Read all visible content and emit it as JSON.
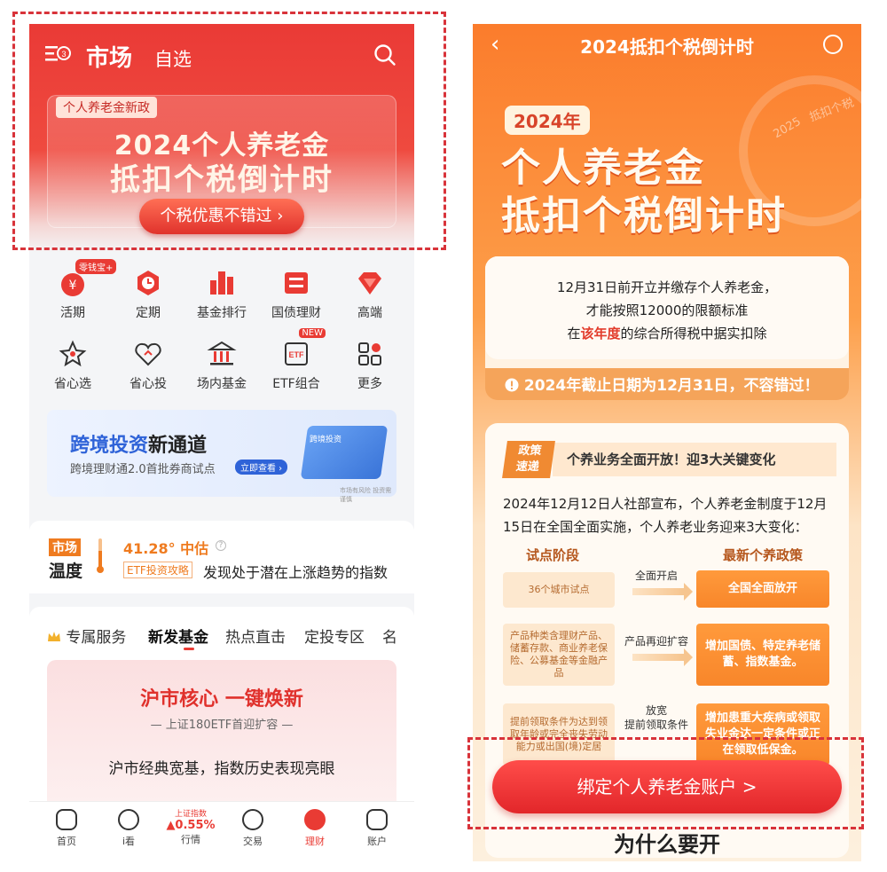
{
  "left": {
    "header": {
      "tab_market": "市场",
      "tab_favorites": "自选",
      "menu_badge": "3"
    },
    "banner": {
      "tag": "个人养老金新政",
      "title_line1": "2024个人养老金",
      "title_line2": "抵扣个税倒计时",
      "button": "个税优惠不错过 ›"
    },
    "grid": [
      {
        "label": "活期",
        "badge": "零钱宝+"
      },
      {
        "label": "定期"
      },
      {
        "label": "基金排行"
      },
      {
        "label": "国债理财"
      },
      {
        "label": "高端"
      },
      {
        "label": "省心选"
      },
      {
        "label": "省心投"
      },
      {
        "label": "场内基金"
      },
      {
        "label": "ETF组合",
        "badge": "NEW"
      },
      {
        "label": "更多"
      }
    ],
    "cross_card": {
      "title_blue": "跨境投资",
      "title_black": "新通道",
      "subtitle": "跨境理财通2.0首批券商试点",
      "button": "立即查看 ›",
      "img_label": "跨境投资",
      "note": "市场有风险 投资需谨慎"
    },
    "temp_card": {
      "badge1": "市场",
      "badge2": "温度",
      "value": "41.28° 中估",
      "etf_tag": "ETF投资攻略",
      "text": "发现处于潜在上涨趋势的指数"
    },
    "service": {
      "tabs": [
        "专属服务",
        "新发基金",
        "热点直击",
        "定投专区",
        "名"
      ],
      "active_tab": "新发基金",
      "promo_title": "沪市核心 一键焕新",
      "promo_sub": "— 上证180ETF首迎扩容 —",
      "promo_text": "沪市经典宽基，指数历史表现亮眼"
    },
    "bottom_nav": {
      "items": [
        "首页",
        "i看",
        "行情",
        "交易",
        "理财",
        "账户"
      ],
      "index_label": "上证指数",
      "index_value": "▲0.55%",
      "active": "理财"
    }
  },
  "right": {
    "nav": {
      "back": "‹",
      "title": "2024抵扣个税倒计时"
    },
    "hero": {
      "year": "2024年",
      "line1": "个人养老金",
      "line2": "抵扣个税倒计时",
      "deco1": "抵扣个税",
      "deco2": "2025"
    },
    "info": {
      "line1": "12月31日前开立并缴存个人养老金，",
      "line2": "才能按照12000的限额标准",
      "line3_pre": "在",
      "line3_hl": "该年度",
      "line3_post": "的综合所得税中据实扣除",
      "deadline": "2024年截止日期为12月31日，不容错过！"
    },
    "policy": {
      "badge_l1": "政策",
      "badge_l2": "速递",
      "title": "个养业务全面开放！迎3大关键变化",
      "text": "2024年12月12日人社部宣布，个人养老金制度于12月15日在全国全面实施，个人养老业务迎来3大变化：",
      "col_left": "试点阶段",
      "col_right": "最新个养政策",
      "rows": [
        {
          "left": "36个城市试点",
          "mid": "全面开启",
          "right": "全国全面放开"
        },
        {
          "left": "产品种类含理财产品、储蓄存款、商业养老保险、公募基金等金融产品",
          "mid": "产品再迎扩容",
          "right": "增加国债、特定养老储蓄、指数基金。"
        },
        {
          "left": "提前领取条件为达到领取年龄或完全丧失劳动能力或出国(境)定居",
          "mid": "放宽\n提前领取条件",
          "right": "增加患重大疾病或领取失业金达一定条件或正在领取低保金。"
        }
      ]
    },
    "cta": "绑定个人养老金账户 >",
    "why": "为什么要开"
  },
  "colors": {
    "brand_red": "#e93b34",
    "orange": "#fb7c2c",
    "highlight_red": "#e23b2b"
  }
}
